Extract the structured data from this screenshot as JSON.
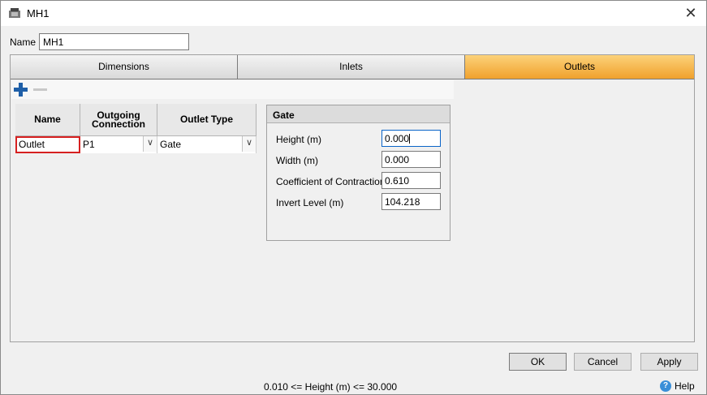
{
  "window": {
    "title": "MH1",
    "close_glyph": "✕",
    "icons": {
      "app": "manhole-icon",
      "close": "close-icon"
    }
  },
  "name_field": {
    "label": "Name",
    "value": "MH1"
  },
  "tabs": [
    {
      "label": "Dimensions",
      "active": false
    },
    {
      "label": "Inlets",
      "active": false
    },
    {
      "label": "Outlets",
      "active": true
    }
  ],
  "colors": {
    "active_tab": "#f0a12c",
    "selected_cell_border": "#d62020",
    "add_icon": "#1f5fa8"
  },
  "toolbar": {
    "add_icon": "plus-icon",
    "remove_icon": "minus-icon"
  },
  "outlets_grid": {
    "columns": [
      "Name",
      "Outgoing Connection",
      "Outlet Type"
    ],
    "rows": [
      {
        "name": "Outlet",
        "connection": "P1",
        "type": "Gate"
      }
    ],
    "dropdown_glyph": "∨"
  },
  "gate_panel": {
    "title": "Gate",
    "fields": [
      {
        "label": "Height (m)",
        "value": "0.000"
      },
      {
        "label": "Width (m)",
        "value": "0.000"
      },
      {
        "label": "Coefficient of Contraction",
        "value": "0.610"
      },
      {
        "label": "Invert Level (m)",
        "value": "104.218"
      }
    ]
  },
  "buttons": {
    "ok": "OK",
    "cancel": "Cancel",
    "apply": "Apply"
  },
  "status": {
    "text": "0.010 <= Height (m) <= 30.000"
  },
  "help": {
    "label": "Help",
    "glyph": "?"
  }
}
